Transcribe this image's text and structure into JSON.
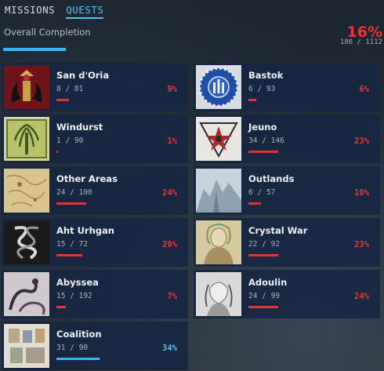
{
  "tabs": [
    {
      "label": "MISSIONS",
      "active": false
    },
    {
      "label": "QUESTS",
      "active": true
    }
  ],
  "overall": {
    "label": "Overall Completion",
    "percent": "16%",
    "count": "186 / 1112",
    "progress": 0.16
  },
  "colors": {
    "accent": "#4fc3f7",
    "low": "#e8343a",
    "card_bg": "#162642"
  },
  "areas": [
    {
      "name": "San d'Oria",
      "count": "8 / 81",
      "percent": "9%",
      "progress": 0.09,
      "thumb": "sandoria-crest"
    },
    {
      "name": "Bastok",
      "count": "6 / 93",
      "percent": "6%",
      "progress": 0.06,
      "thumb": "bastok-crest"
    },
    {
      "name": "Windurst",
      "count": "1 / 90",
      "percent": "1%",
      "progress": 0.01,
      "thumb": "windurst-crest"
    },
    {
      "name": "Jeuno",
      "count": "34 / 146",
      "percent": "23%",
      "progress": 0.23,
      "thumb": "jeuno-crest"
    },
    {
      "name": "Other Areas",
      "count": "24 / 100",
      "percent": "24%",
      "progress": 0.24,
      "thumb": "map-image"
    },
    {
      "name": "Outlands",
      "count": "6 / 57",
      "percent": "10%",
      "progress": 0.1,
      "thumb": "outlands-art"
    },
    {
      "name": "Aht Urhgan",
      "count": "15 / 72",
      "percent": "20%",
      "progress": 0.2,
      "thumb": "aht-urhgan-crest"
    },
    {
      "name": "Crystal War",
      "count": "22 / 92",
      "percent": "23%",
      "progress": 0.23,
      "thumb": "crystal-war-art"
    },
    {
      "name": "Abyssea",
      "count": "15 / 192",
      "percent": "7%",
      "progress": 0.07,
      "thumb": "abyssea-art"
    },
    {
      "name": "Adoulin",
      "count": "24 / 99",
      "percent": "24%",
      "progress": 0.24,
      "thumb": "adoulin-art"
    },
    {
      "name": "Coalition",
      "count": "31 / 90",
      "percent": "34%",
      "progress": 0.34,
      "thumb": "coalition-art",
      "highlight": true
    }
  ]
}
